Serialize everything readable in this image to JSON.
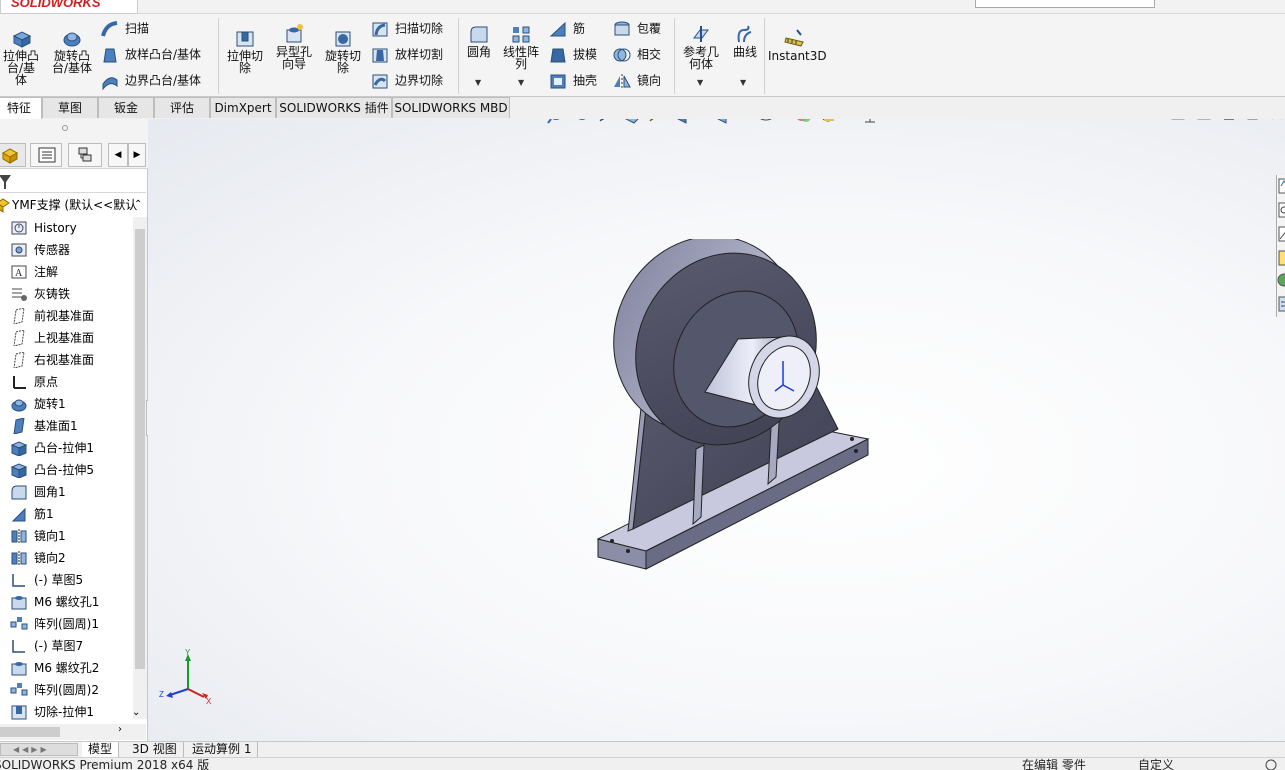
{
  "app": {
    "logo": "SOLIDWORKS"
  },
  "ribbon": {
    "extrude_boss": "拉伸凸台/基体",
    "revolve_boss": "旋转凸台/基体",
    "sweep": "扫描",
    "loft": "放样凸台/基体",
    "boundary": "边界凸台/基体",
    "extrude_cut": "拉伸切除",
    "hole_wizard": "异型孔向导",
    "revolve_cut": "旋转切除",
    "swept_cut": "扫描切除",
    "lofted_cut": "放样切割",
    "boundary_cut": "边界切除",
    "fillet": "圆角",
    "linear_pattern": "线性阵列",
    "rib": "筋",
    "draft": "拔模",
    "shell": "抽壳",
    "wrap": "包覆",
    "intersect": "相交",
    "mirror": "镜向",
    "ref_geometry": "参考几何体",
    "curves": "曲线",
    "instant3d": "Instant3D"
  },
  "tabs": [
    "特征",
    "草图",
    "钣金",
    "评估",
    "DimXpert",
    "SOLIDWORKS 插件",
    "SOLIDWORKS MBD"
  ],
  "tree": {
    "root": "YMF支撑  (默认<<默认",
    "items": [
      "History",
      "传感器",
      "注解",
      "灰铸铁",
      "前视基准面",
      "上视基准面",
      "右视基准面",
      "原点",
      "旋转1",
      "基准面1",
      "凸台-拉伸1",
      "凸台-拉伸5",
      "圆角1",
      "筋1",
      "镜向1",
      "镜向2",
      "(-) 草图5",
      "M6 螺纹孔1",
      "阵列(圆周)1",
      "(-) 草图7",
      "M6 螺纹孔2",
      "阵列(圆周)2",
      "切除-拉伸1"
    ]
  },
  "triad": {
    "y": "Y",
    "x": "X",
    "z": "Z"
  },
  "bottom_tabs": [
    "模型",
    "3D 视图",
    "运动算例 1"
  ],
  "status": {
    "left": "SOLIDWORKS Premium 2018 x64 版",
    "editing": "在编辑 零件",
    "custom": "自定义"
  }
}
